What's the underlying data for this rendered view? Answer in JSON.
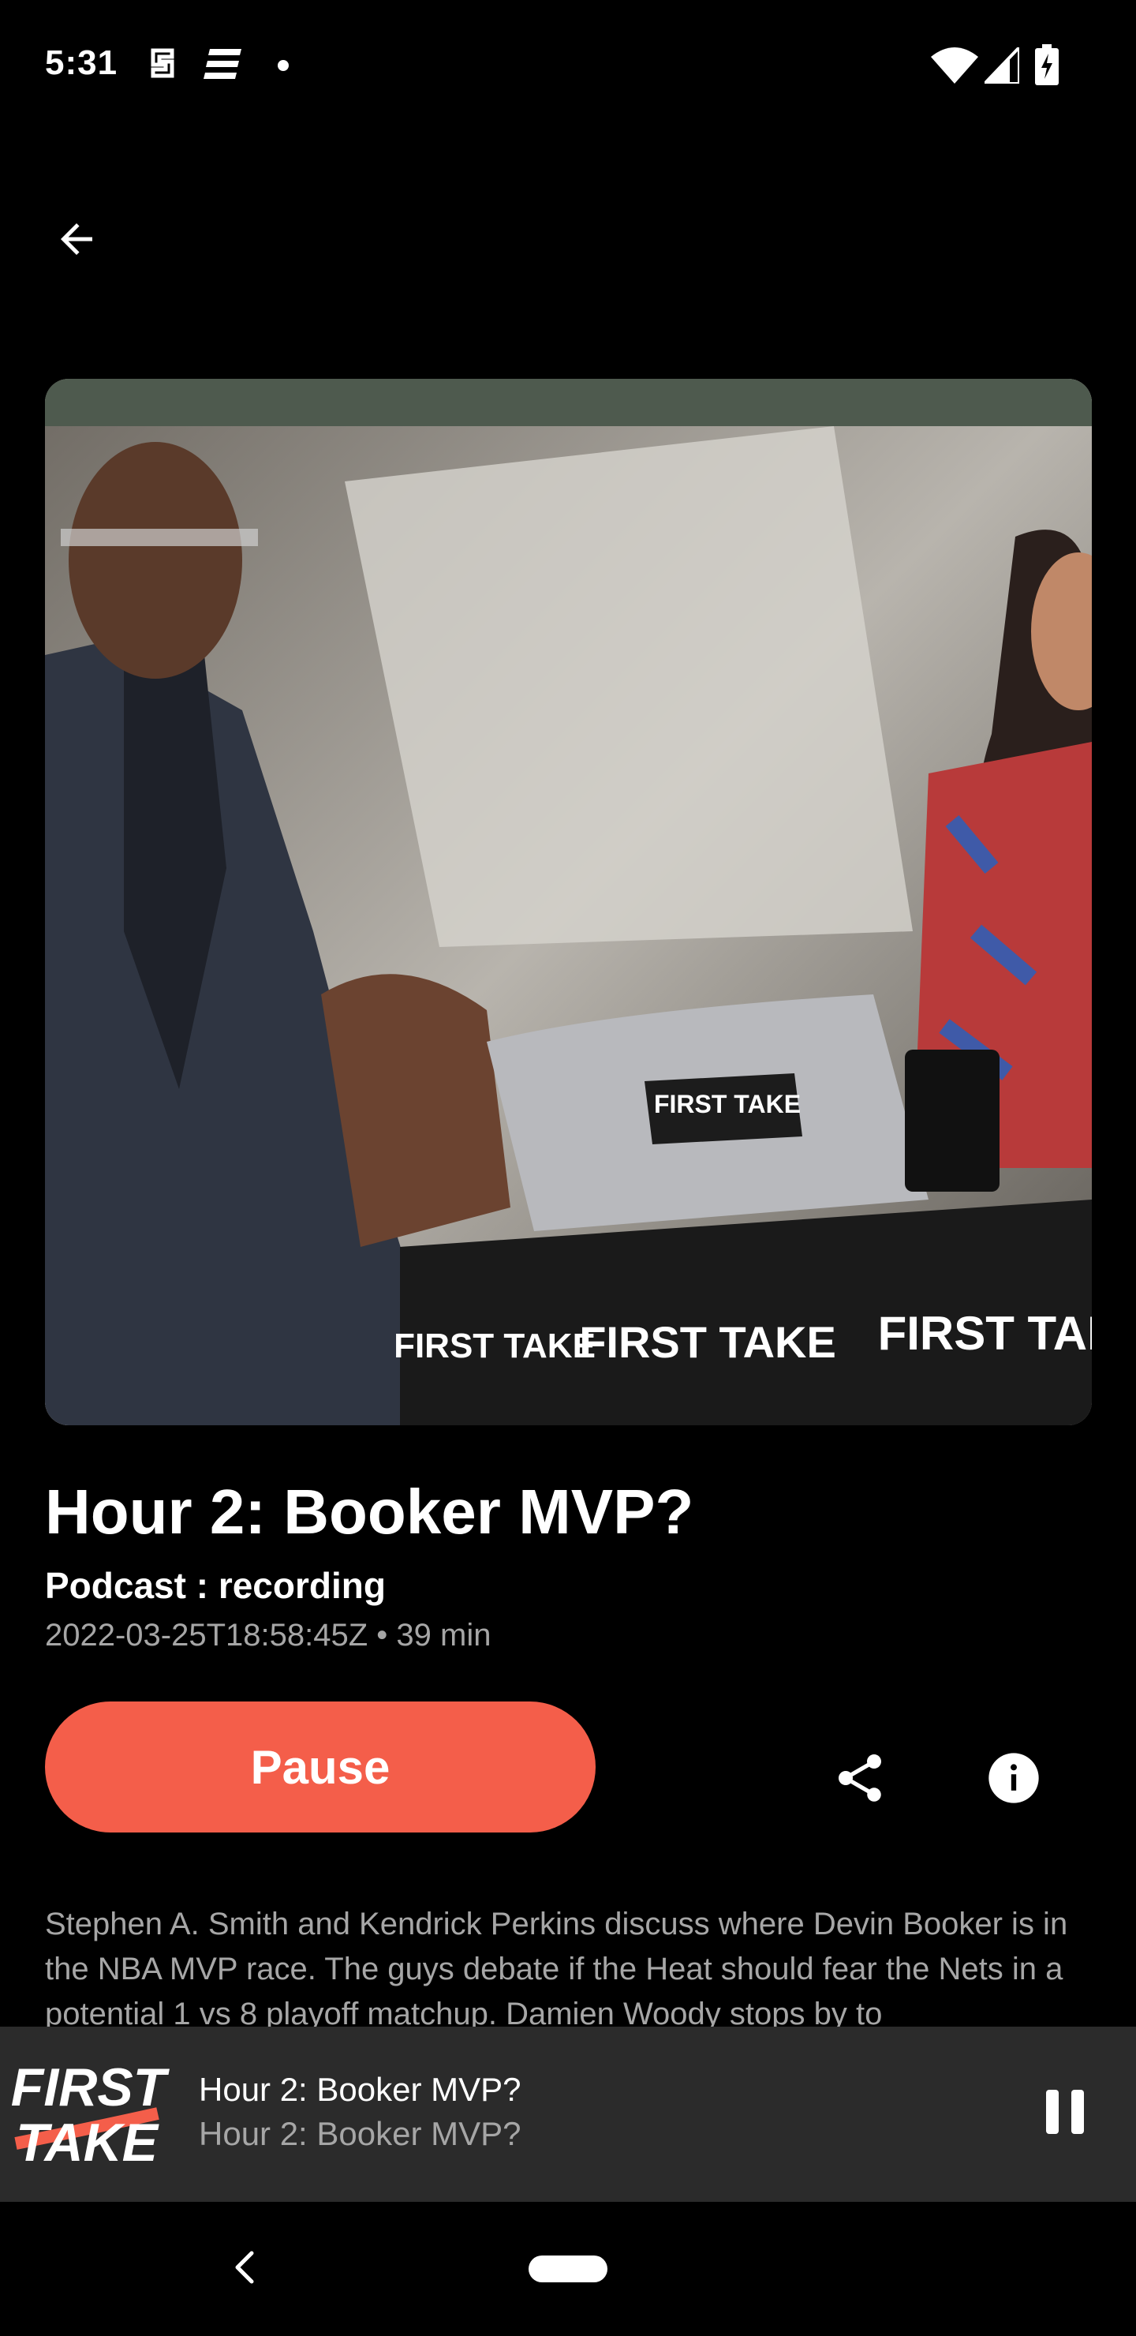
{
  "status": {
    "time": "5:31",
    "icons": [
      "notification-s-icon",
      "espn-icon",
      "dot-icon",
      "wifi-icon",
      "signal-icon",
      "battery-charging-icon"
    ]
  },
  "app_bar": {
    "back_icon": "arrow-back-icon"
  },
  "episode": {
    "title": "Hour 2: Booker MVP?",
    "podcast_line": "Podcast : recording",
    "meta": "2022-03-25T18:58:45Z • 39 min",
    "description": "Stephen A. Smith and Kendrick Perkins discuss where Devin Booker is in the NBA MVP race. The guys debate if the Heat should fear the Nets in a potential 1 vs 8 playoff matchup. Damien Woody stops by to"
  },
  "artwork": {
    "laptop_logo": "FIRST TAKE",
    "desk_logos": [
      "FIRST TAKE",
      "FIRST TAKE",
      "FIRST TAKE"
    ]
  },
  "actions": {
    "pause_label": "Pause",
    "share_icon": "share-icon",
    "info_icon": "info-icon",
    "accent": "#f45e4a"
  },
  "mini_player": {
    "logo_line1": "FIRST",
    "logo_line2": "TAKE",
    "title": "Hour 2: Booker MVP?",
    "subtitle": "Hour 2: Booker MVP?",
    "pause_icon": "pause-icon"
  },
  "nav": {
    "back_icon": "nav-back-icon",
    "home_icon": "home-pill-icon"
  }
}
